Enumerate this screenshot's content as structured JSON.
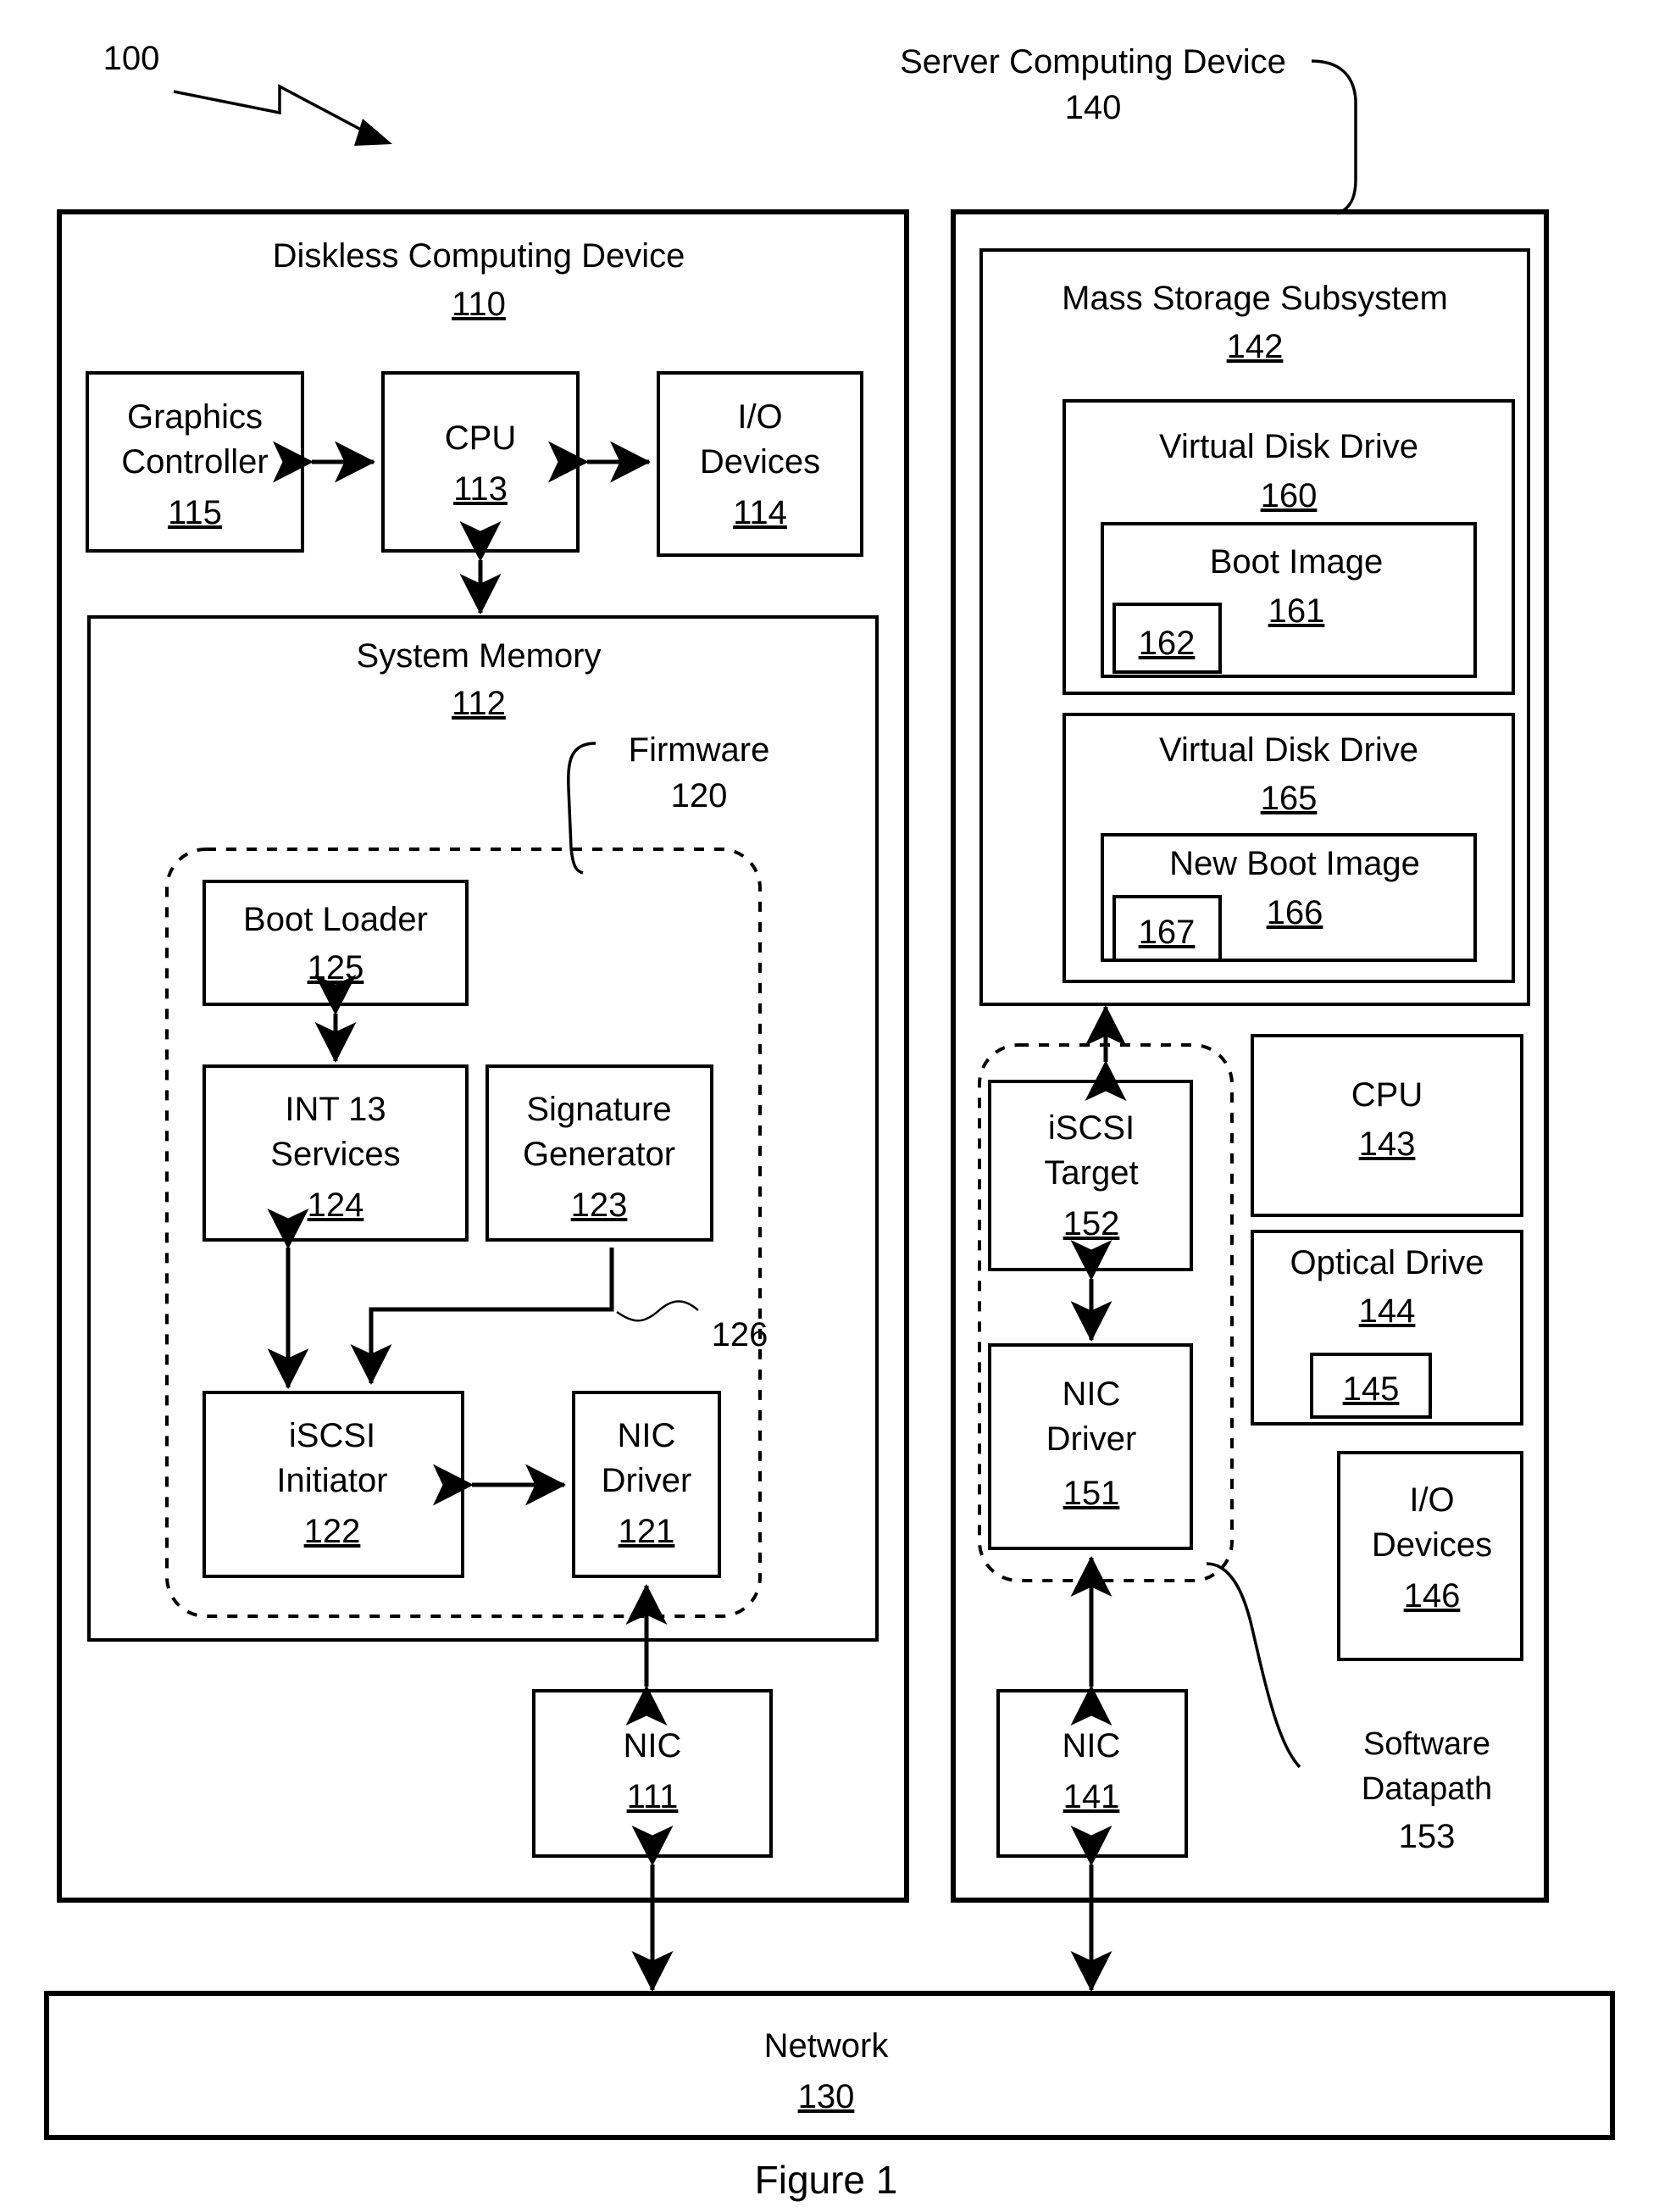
{
  "figure": {
    "caption": "Figure 1",
    "system_ref": "100"
  },
  "titles": {
    "server_device": "Server Computing Device",
    "server_device_ref": "140",
    "diskless_device": "Diskless Computing Device",
    "diskless_device_ref": "110",
    "system_memory": "System Memory",
    "system_memory_ref": "112",
    "firmware": "Firmware",
    "firmware_ref": "120",
    "mass_storage": "Mass Storage Subsystem",
    "mass_storage_ref": "142",
    "software_datapath_line1": "Software",
    "software_datapath_line2": "Datapath",
    "software_datapath_ref": "153",
    "connector_126_ref": "126"
  },
  "client": {
    "graphics_controller": {
      "line1": "Graphics",
      "line2": "Controller",
      "ref": "115"
    },
    "cpu": {
      "line1": "CPU",
      "ref": "113"
    },
    "io_devices": {
      "line1": "I/O",
      "line2": "Devices",
      "ref": "114"
    },
    "boot_loader": {
      "line1": "Boot Loader",
      "ref": "125"
    },
    "int13_services": {
      "line1": "INT 13",
      "line2": "Services",
      "ref": "124"
    },
    "signature_generator": {
      "line1": "Signature",
      "line2": "Generator",
      "ref": "123"
    },
    "iscsi_initiator": {
      "line1": "iSCSI",
      "line2": "Initiator",
      "ref": "122"
    },
    "nic_driver": {
      "line1": "NIC",
      "line2": "Driver",
      "ref": "121"
    },
    "nic": {
      "line1": "NIC",
      "ref": "111"
    }
  },
  "server": {
    "virtual_disk_drive_1": {
      "line1": "Virtual Disk Drive",
      "ref": "160"
    },
    "boot_image": {
      "line1": "Boot Image",
      "ref": "161"
    },
    "boot_image_sub_ref": "162",
    "virtual_disk_drive_2": {
      "line1": "Virtual Disk Drive",
      "ref": "165"
    },
    "new_boot_image": {
      "line1": "New Boot Image",
      "ref": "166"
    },
    "new_boot_image_sub_ref": "167",
    "iscsi_target": {
      "line1": "iSCSI",
      "line2": "Target",
      "ref": "152"
    },
    "nic_driver": {
      "line1": "NIC",
      "line2": "Driver",
      "ref": "151"
    },
    "nic": {
      "line1": "NIC",
      "ref": "141"
    },
    "cpu": {
      "line1": "CPU",
      "ref": "143"
    },
    "optical_drive": {
      "line1": "Optical Drive",
      "ref": "144"
    },
    "optical_drive_sub_ref": "145",
    "io_devices": {
      "line1": "I/O",
      "line2": "Devices",
      "ref": "146"
    }
  },
  "network": {
    "label": "Network",
    "ref": "130"
  },
  "colors": {
    "stroke": "#000000",
    "background": "#ffffff"
  }
}
